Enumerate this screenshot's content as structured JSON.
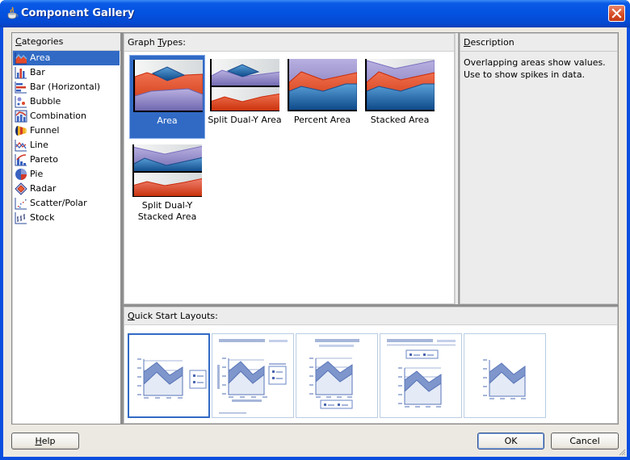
{
  "window": {
    "title": "Component Gallery",
    "app_icon": "java-cup-icon",
    "close_icon": "close-icon"
  },
  "categories": {
    "header": "Categories",
    "header_mnemonic": "C",
    "header_rest": "ategories",
    "items": [
      {
        "label": "Area",
        "icon": "area-chart-icon",
        "selected": true
      },
      {
        "label": "Bar",
        "icon": "bar-chart-icon",
        "selected": false
      },
      {
        "label": "Bar (Horizontal)",
        "icon": "horizontal-bar-chart-icon",
        "selected": false
      },
      {
        "label": "Bubble",
        "icon": "bubble-chart-icon",
        "selected": false
      },
      {
        "label": "Combination",
        "icon": "combination-chart-icon",
        "selected": false
      },
      {
        "label": "Funnel",
        "icon": "funnel-chart-icon",
        "selected": false
      },
      {
        "label": "Line",
        "icon": "line-chart-icon",
        "selected": false
      },
      {
        "label": "Pareto",
        "icon": "pareto-chart-icon",
        "selected": false
      },
      {
        "label": "Pie",
        "icon": "pie-chart-icon",
        "selected": false
      },
      {
        "label": "Radar",
        "icon": "radar-chart-icon",
        "selected": false
      },
      {
        "label": "Scatter/Polar",
        "icon": "scatter-chart-icon",
        "selected": false
      },
      {
        "label": "Stock",
        "icon": "stock-chart-icon",
        "selected": false
      }
    ]
  },
  "graph_types": {
    "header_pre": "Graph ",
    "header_mnemonic": "T",
    "header_rest": "ypes:",
    "items": [
      {
        "label": "Area",
        "selected": true
      },
      {
        "label": "Split Dual-Y Area",
        "selected": false
      },
      {
        "label": "Percent Area",
        "selected": false
      },
      {
        "label": "Stacked Area",
        "selected": false
      },
      {
        "label": "Split Dual-Y Stacked Area",
        "selected": false
      }
    ]
  },
  "description": {
    "header_mnemonic": "D",
    "header_rest": "escription",
    "text": "Overlapping areas show values. Use to show spikes in data."
  },
  "quick_start": {
    "header_mnemonic": "Q",
    "header_rest": "uick Start Layouts:",
    "layouts": [
      {
        "name": "chart-legend-right",
        "selected": true
      },
      {
        "name": "title-chart-legend-right-axis-titles",
        "selected": false
      },
      {
        "name": "title-chart-legend-bottom",
        "selected": false
      },
      {
        "name": "title-legend-top-chart",
        "selected": false
      },
      {
        "name": "chart-only",
        "selected": false
      }
    ]
  },
  "buttons": {
    "help_mnemonic": "H",
    "help_rest": "elp",
    "ok": "OK",
    "cancel": "Cancel"
  },
  "colors": {
    "title_bar": "#0452e0",
    "selection": "#316ac5",
    "close_button": "#d74a22",
    "area_red": "#d8401a",
    "area_purple": "#9b90cc",
    "area_blue": "#2f7ab8"
  }
}
